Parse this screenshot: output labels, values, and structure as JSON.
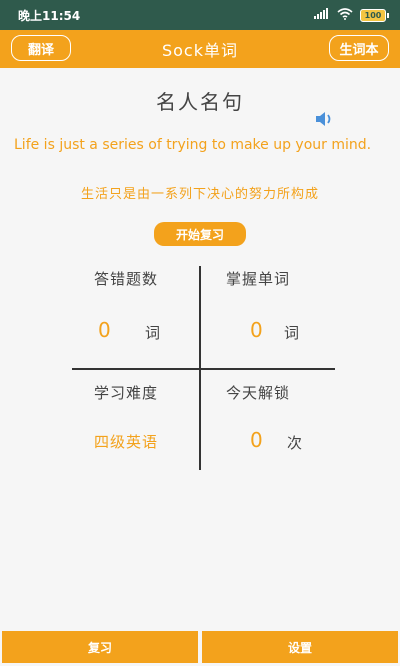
{
  "status_bar": {
    "time": "晚上11:54",
    "battery": "100",
    "icons": [
      "signal-icon",
      "wifi-icon",
      "battery-icon"
    ]
  },
  "app_bar": {
    "title": "Sock单词",
    "left_button": "翻译",
    "right_button": "生词本"
  },
  "quote": {
    "title": "名人名句",
    "english": "Life is just a series of trying to make up your mind.",
    "chinese": "生活只是由一系列下决心的努力所构成"
  },
  "start_review": "开始复习",
  "stats": {
    "wrong": {
      "label": "答错题数",
      "value": "0",
      "unit": "词"
    },
    "mastered": {
      "label": "掌握单词",
      "value": "0",
      "unit": "词"
    },
    "difficulty": {
      "label": "学习难度",
      "value": "四级英语"
    },
    "unlocked": {
      "label": "今天解锁",
      "value": "0",
      "unit": "次"
    }
  },
  "bottom": {
    "review": "复习",
    "settings": "设置"
  },
  "colors": {
    "accent": "#f3a21c",
    "status_bar": "#2f5a4c",
    "speaker": "#4a90d9"
  }
}
